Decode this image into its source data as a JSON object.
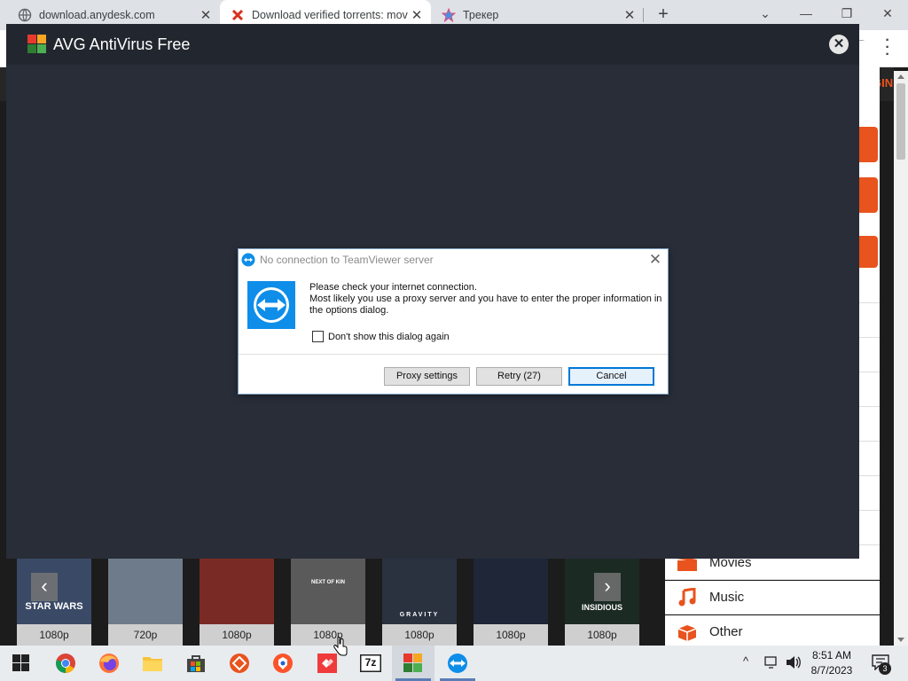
{
  "browser": {
    "tabs": [
      {
        "title": "download.anydesk.com",
        "close": "✕",
        "active": false
      },
      {
        "title": "Download verified torrents: movi",
        "close": "✕",
        "active": true
      },
      {
        "title": "Трекер",
        "close": "✕",
        "active": false
      }
    ],
    "new_tab": "+",
    "window_controls": {
      "dropdown": "⌄",
      "minimize": "—",
      "restore": "❐",
      "close": "✕"
    }
  },
  "website": {
    "login_label": "LOGIN",
    "categories": [
      {
        "label": "Movies",
        "icon": "movie-clapper-icon"
      },
      {
        "label": "Music",
        "icon": "music-note-icon"
      },
      {
        "label": "Other",
        "icon": "box-icon"
      }
    ],
    "posters": [
      {
        "quality": "1080p",
        "title": "STAR WARS",
        "color": "#3a4a66"
      },
      {
        "quality": "720p",
        "title": "",
        "color": "#6e7b8a"
      },
      {
        "quality": "1080p",
        "title": "",
        "color": "#7a2a24"
      },
      {
        "quality": "1080p",
        "title": "NEXT OF KIN",
        "color": "#5a5a5a"
      },
      {
        "quality": "1080p",
        "title": "GRAVITY",
        "color": "#2a3240"
      },
      {
        "quality": "1080p",
        "title": "",
        "color": "#1e2638"
      },
      {
        "quality": "1080p",
        "title": "INSIDIOUS",
        "color": "#1c2a24"
      }
    ],
    "accent_color": "#e8531e"
  },
  "avg": {
    "title": "AVG AntiVirus Free",
    "close": "✕"
  },
  "dialog": {
    "title": "No connection to TeamViewer server",
    "close": "✕",
    "message_line1": "Please check your internet connection.",
    "message_line2": "Most likely you use a proxy server and you have to enter the proper information in the options dialog.",
    "checkbox_label": "Don't show this dialog again",
    "checkbox_checked": false,
    "buttons": {
      "proxy": "Proxy settings",
      "retry": "Retry (27)",
      "cancel": "Cancel"
    }
  },
  "taskbar": {
    "time": "8:51 AM",
    "date": "8/7/2023",
    "notification_count": "3",
    "apps": [
      "start-icon",
      "chrome-icon",
      "firefox-icon",
      "file-explorer-icon",
      "store-icon",
      "anydesk-icon",
      "brave-icon",
      "anydesk-red-icon",
      "7zip-icon",
      "avg-icon",
      "teamviewer-icon"
    ],
    "sevenzip_label": "7z"
  }
}
